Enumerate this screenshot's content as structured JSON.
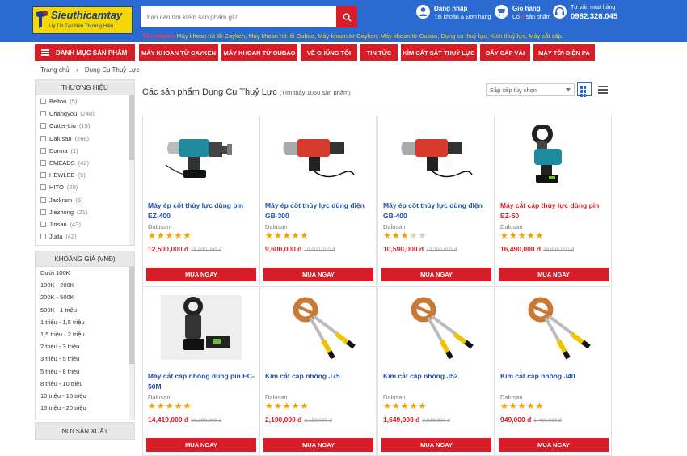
{
  "header": {
    "logo_title": "Sieuthicamtay",
    "logo_tagline": "Uy Tín Tạo Nên Thương Hiệu",
    "search_placeholder": "bạn cần tìm kiếm sản phẩm gì?",
    "quick_label": "Tìm nhanh:",
    "quick_links": "Máy khoan rút lõi Cayken, Máy khoan rút lõi Oubao, Máy khoan từ Cayken, Máy khoan từ Oubao, Dụng cụ thuỷ lực, Kích thuỷ lực, Máy cắt cáp.",
    "login_title": "Đăng nhập",
    "login_sub": "Tài khoản & Đơn hàng",
    "cart_title": "Giỏ hàng",
    "cart_sub_prefix": "Có",
    "cart_count": "0",
    "cart_sub_suffix": "sản phẩm",
    "support_title": "Tư vấn mua hàng",
    "support_phone": "0982.328.045"
  },
  "nav": {
    "menu_label": "DANH MỤC SẢN PHẨM",
    "items": [
      "MÁY KHOAN TỪ CAYKEN",
      "MÁY KHOAN TỪ OUBAO",
      "VỀ CHÚNG TÔI",
      "TIN TỨC",
      "KÌM CẮT SẮT THUỶ LỰC",
      "DÂY CÁP VẢI",
      "MÁY TỜI ĐIỆN PA"
    ]
  },
  "breadcrumb": {
    "home": "Trang chủ",
    "sep": "›",
    "current": "Dụng Cụ Thuỷ Lực"
  },
  "sidebar": {
    "brand_title": "THƯƠNG HIỆU",
    "brands": [
      {
        "name": "Belton",
        "count": "(5)"
      },
      {
        "name": "Changyou",
        "count": "(248)"
      },
      {
        "name": "Cutter-Liu",
        "count": "(15)"
      },
      {
        "name": "Dalusan",
        "count": "(266)"
      },
      {
        "name": "Dorma",
        "count": "(1)"
      },
      {
        "name": "EMEADS",
        "count": "(42)"
      },
      {
        "name": "HEWLEE",
        "count": "(5)"
      },
      {
        "name": "HITO",
        "count": "(20)"
      },
      {
        "name": "Jackram",
        "count": "(5)"
      },
      {
        "name": "Jiezhong",
        "count": "(21)"
      },
      {
        "name": "Jinsan",
        "count": "(43)"
      },
      {
        "name": "Juda",
        "count": "(42)"
      }
    ],
    "price_title": "KHOẢNG GIÁ (VNĐ)",
    "prices": [
      "Dưới 100K",
      "100K - 200K",
      "200K - 500K",
      "500K - 1 triệu",
      "1 triệu - 1,5 triệu",
      "1,5 triệu - 2 triệu",
      "2 triệu - 3 triệu",
      "3 triệu - 5 triệu",
      "5 triệu - 8 triệu",
      "8 triệu - 10 triệu",
      "10 triệu - 15 triệu",
      "15 triệu - 20 triệu"
    ],
    "origin_title": "NƠI SẢN XUẤT"
  },
  "main": {
    "title": "Các sản phẩm Dụng Cụ Thuỷ Lực",
    "found": "(Tìm thấy 1060 sản phẩm)",
    "sort_label": "Sắp xếp tùy chọn"
  },
  "colors": {
    "brand_blue": "#2b6ad1",
    "accent_red": "#d71e28",
    "star": "#f5a100"
  },
  "products": [
    {
      "name": "Máy ép cốt thủy lực dùng pin EZ-400",
      "brand": "Dalusan",
      "rating": 5,
      "price": "12,500,000 đ",
      "old_price": "15,900,000 đ",
      "buy": "MUA NGAY",
      "img": "crimper-battery-icon",
      "highlight": false
    },
    {
      "name": "Máy ép cốt thủy lực dùng điện GB-300",
      "brand": "Dalusan",
      "rating": 5,
      "price": "9,600,000 đ",
      "old_price": "10,900,000 đ",
      "buy": "MUA NGAY",
      "img": "crimper-electric-icon",
      "highlight": false
    },
    {
      "name": "Máy ép cốt thủy lực dùng điện GB-400",
      "brand": "Dalusan",
      "rating": 3,
      "price": "10,590,000 đ",
      "old_price": "12,200,000 đ",
      "buy": "MUA NGAY",
      "img": "crimper-electric-icon",
      "highlight": false
    },
    {
      "name": "Máy cắt cáp thủy lực dùng pin EZ-50",
      "brand": "Dalusan",
      "rating": 5,
      "price": "16,490,000 đ",
      "old_price": "18,900,000 đ",
      "buy": "MUA NGAY",
      "img": "cable-cutter-battery-icon",
      "highlight": true
    },
    {
      "name": "Máy cắt cáp nhông dùng pin EC-50M",
      "brand": "Dalusan",
      "rating": 5,
      "price": "14,419,000 đ",
      "old_price": "16,200,000 đ",
      "buy": "MUA NGAY",
      "img": "cable-cutter-black-icon",
      "highlight": false
    },
    {
      "name": "Kìm cắt cáp nhông J75",
      "brand": "Dalusan",
      "rating": 5,
      "price": "2,190,000 đ",
      "old_price": "3,150,000 đ",
      "buy": "MUA NGAY",
      "img": "ratchet-cutter-icon",
      "highlight": false
    },
    {
      "name": "Kìm cắt cáp nhông J52",
      "brand": "Dalusan",
      "rating": 5,
      "price": "1,649,000 đ",
      "old_price": "2,239,000 đ",
      "buy": "MUA NGAY",
      "img": "ratchet-cutter-icon",
      "highlight": false
    },
    {
      "name": "Kìm cắt cáp nhông J40",
      "brand": "Dalusan",
      "rating": 5,
      "price": "949,000 đ",
      "old_price": "1,490,000 đ",
      "buy": "MUA NGAY",
      "img": "ratchet-cutter-icon",
      "highlight": false
    }
  ]
}
